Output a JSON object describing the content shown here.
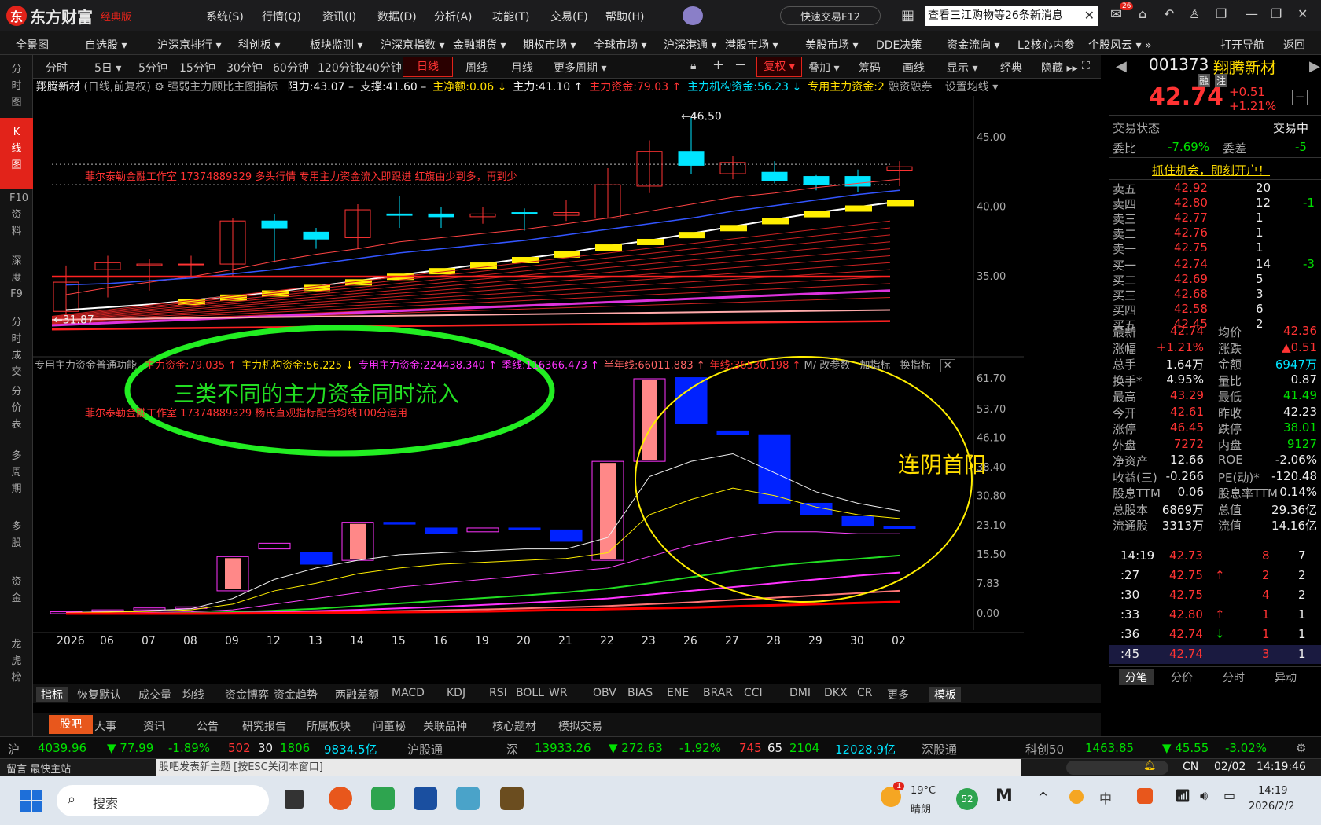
{
  "app": {
    "logo_text": "东方财富",
    "edition": "经典版"
  },
  "menu": [
    "系统(S)",
    "行情(Q)",
    "资讯(I)",
    "数据(D)",
    "分析(A)",
    "功能(T)",
    "交易(E)",
    "帮助(H)"
  ],
  "quick_trade": "快速交易F12",
  "search_notice": "查看三江购物等26条新消息",
  "mail_badge": "26",
  "nav": [
    "全景图",
    "自选股 ▾",
    "沪深京排行 ▾",
    "科创板 ▾",
    "板块监测 ▾",
    "沪深京指数 ▾",
    "金融期货 ▾",
    "期权市场 ▾",
    "全球市场 ▾",
    "沪深港通 ▾",
    "港股市场 ▾",
    "美股市场 ▾",
    "DDE决策",
    "资金流向 ▾",
    "L2核心内参",
    "个股风云 ▾ »",
    "打开导航",
    "返回"
  ],
  "left_strip": [
    "分时图",
    "K线图",
    "F10资料",
    "深度F9",
    "分时成交",
    "分价表",
    "多周期",
    "多股",
    "资金",
    "龙虎榜"
  ],
  "periods": [
    "分时",
    "5日 ▾",
    "5分钟",
    "15分钟",
    "30分钟",
    "60分钟",
    "120分钟",
    "240分钟",
    "日线",
    "周线",
    "月线",
    "更多周期 ▾"
  ],
  "toolbar": [
    "复权 ▾",
    "叠加 ▾",
    "筹码",
    "画线",
    "显示 ▾",
    "经典",
    "隐藏 ▸▸"
  ],
  "kline_header": {
    "name": "翔腾新材",
    "mode": "(日线,前复权)",
    "indicator": "强弱主力顾比主图指标",
    "items": [
      {
        "t": "阻力:43.07 –",
        "c": "#eee"
      },
      {
        "t": "支撑:41.60 –",
        "c": "#eee"
      },
      {
        "t": "主净额:0.06 ↓",
        "c": "#ffdd00"
      },
      {
        "t": "主力:41.10 ↑",
        "c": "#eee"
      },
      {
        "t": "主力资金:79.03 ↑",
        "c": "#ff3333"
      },
      {
        "t": "主力机构资金:56.23 ↓",
        "c": "#00e5ff"
      },
      {
        "t": "专用主力资金:2",
        "c": "#ffdd00"
      }
    ],
    "extra": "融资融券",
    "settings": "设置均线 ▾"
  },
  "kline_yaxis": [
    "45.00",
    "40.00",
    "35.00"
  ],
  "kline_high_label": "←46.50",
  "kline_low_label": "←31.87",
  "kline_note": "菲尔泰勒金融工作室 17374889329 多头行情 专用主力资金流入即跟进 红旗由少到多，再到少",
  "sub_header": {
    "name": "专用主力资金普通功能",
    "items": [
      {
        "t": "主力资金:79.035 ↑",
        "c": "#ff3333"
      },
      {
        "t": "主力机构资金:56.225 ↓",
        "c": "#ffdd00"
      },
      {
        "t": "专用主力资金:224438.340 ↑",
        "c": "#ff33ff"
      },
      {
        "t": "季线:116366.473 ↑",
        "c": "#ff33ff"
      },
      {
        "t": "半年线:66011.883 ↑",
        "c": "#ff6666"
      },
      {
        "t": "年线:36530.198 ↑",
        "c": "#ff3333"
      }
    ],
    "tools": [
      "M/",
      "改参数",
      "加指标",
      "换指标"
    ]
  },
  "sub_note": "菲尔泰勒金融工作室 17374889329 杨氏直观指标配合均线100分运用",
  "annot_green": "三类不同的主力资金同时流入",
  "annot_yellow": "连阴首阳",
  "sub_yaxis": [
    "61.70",
    "53.70",
    "46.10",
    "38.40",
    "30.80",
    "23.10",
    "15.50",
    "7.83",
    "0.00"
  ],
  "date_axis": [
    "2026",
    "06",
    "07",
    "08",
    "09",
    "12",
    "13",
    "14",
    "15",
    "16",
    "19",
    "20",
    "21",
    "22",
    "23",
    "26",
    "27",
    "28",
    "29",
    "30",
    "02"
  ],
  "bottom_indicators": [
    "指标",
    "恢复默认",
    "成交量",
    "均线",
    "资金博弈",
    "资金趋势",
    "两融差额",
    "MACD",
    "KDJ",
    "RSI",
    "BOLL",
    "WR",
    "OBV",
    "BIAS",
    "ENE",
    "BRAR",
    "CCI",
    "DMI",
    "DKX",
    "CR",
    "更多",
    "模板"
  ],
  "info_tabs": [
    "股吧",
    "大事",
    "资讯",
    "公告",
    "研究报告",
    "所属板块",
    "问董秘",
    "关联品种",
    "核心题材",
    "模拟交易"
  ],
  "quote": {
    "code": "001373",
    "name": "翔腾新材",
    "tags": [
      "融",
      "注"
    ],
    "price": "42.74",
    "change": "+0.51",
    "pct": "+1.21%",
    "status_label": "交易状态",
    "status": "交易中",
    "weibi_label": "委比",
    "weibi": "-7.69%",
    "weicha_label": "委差",
    "weicha": "-5",
    "promo": "抓住机会，即刻开户！",
    "asks": [
      {
        "l": "卖五",
        "p": "42.92",
        "v": "20",
        "d": ""
      },
      {
        "l": "卖四",
        "p": "42.80",
        "v": "12",
        "d": "-1"
      },
      {
        "l": "卖三",
        "p": "42.77",
        "v": "1",
        "d": ""
      },
      {
        "l": "卖二",
        "p": "42.76",
        "v": "1",
        "d": ""
      },
      {
        "l": "卖一",
        "p": "42.75",
        "v": "1",
        "d": ""
      }
    ],
    "bids": [
      {
        "l": "买一",
        "p": "42.74",
        "v": "14",
        "d": "-3"
      },
      {
        "l": "买二",
        "p": "42.69",
        "v": "5",
        "d": ""
      },
      {
        "l": "买三",
        "p": "42.68",
        "v": "3",
        "d": ""
      },
      {
        "l": "买四",
        "p": "42.58",
        "v": "6",
        "d": ""
      },
      {
        "l": "买五",
        "p": "42.45",
        "v": "2",
        "d": ""
      }
    ],
    "stats": [
      [
        "最新",
        "42.74",
        "#ff3333",
        "均价",
        "42.36",
        "#ff3333"
      ],
      [
        "涨幅",
        "+1.21%",
        "#ff3333",
        "涨跌",
        "▲0.51",
        "#ff3333"
      ],
      [
        "总手",
        "1.64万",
        "#eee",
        "金额",
        "6947万",
        "#00e5ff"
      ],
      [
        "换手*",
        "4.95%",
        "#eee",
        "量比",
        "0.87",
        "#eee"
      ],
      [
        "最高",
        "43.29",
        "#ff3333",
        "最低",
        "41.49",
        "#00e000"
      ],
      [
        "今开",
        "42.61",
        "#ff3333",
        "昨收",
        "42.23",
        "#eee"
      ],
      [
        "涨停",
        "46.45",
        "#ff3333",
        "跌停",
        "38.01",
        "#00e000"
      ],
      [
        "外盘",
        "7272",
        "#ff3333",
        "内盘",
        "9127",
        "#00e000"
      ],
      [
        "净资产",
        "12.66",
        "#eee",
        "ROE",
        "-2.06%",
        "#eee"
      ],
      [
        "收益(三)",
        "-0.266",
        "#eee",
        "PE(动)*",
        "-120.48",
        "#eee"
      ],
      [
        "股息TTM",
        "0.06",
        "#eee",
        "股息率TTM",
        "0.14%",
        "#eee"
      ],
      [
        "总股本",
        "6869万",
        "#eee",
        "总值",
        "29.36亿",
        "#eee"
      ],
      [
        "流通股",
        "3313万",
        "#eee",
        "流值",
        "14.16亿",
        "#eee"
      ]
    ],
    "ticks": [
      {
        "t": "14:19",
        "p": "42.73",
        "v": "8",
        "n": "7",
        "a": ""
      },
      {
        "t": ":27",
        "p": "42.75",
        "v": "2",
        "n": "2",
        "a": "↑"
      },
      {
        "t": ":30",
        "p": "42.75",
        "v": "4",
        "n": "2",
        "a": ""
      },
      {
        "t": ":33",
        "p": "42.80",
        "v": "1",
        "n": "1",
        "a": "↑"
      },
      {
        "t": ":36",
        "p": "42.74",
        "v": "1",
        "n": "1",
        "a": "↓"
      },
      {
        "t": ":45",
        "p": "42.74",
        "v": "3",
        "n": "1",
        "a": ""
      }
    ],
    "tabs": [
      "分笔",
      "分价",
      "分时",
      "异动"
    ]
  },
  "index_bar": {
    "sh": {
      "l": "沪",
      "v": "4039.96",
      "chg": "▼ 77.99",
      "pct": "-1.89%",
      "u": "502",
      "f": "30",
      "d": "1806",
      "amt": "9834.5亿"
    },
    "hgt": "沪股通",
    "sz": {
      "l": "深",
      "v": "13933.26",
      "chg": "▼ 272.63",
      "pct": "-1.92%",
      "u": "745",
      "f": "65",
      "d": "2104",
      "amt": "12028.9亿"
    },
    "sgt": "深股通",
    "kc": {
      "l": "科创50",
      "v": "1463.85",
      "chg": "▼ 45.55",
      "pct": "-3.02%"
    }
  },
  "status_bar": {
    "left": "留言  最快主站",
    "popup": "股吧发表新主题 [按ESC关闭本窗口]",
    "lang": "CN",
    "date": "02/02",
    "time": "14:19:46"
  },
  "taskbar": {
    "search": "搜索",
    "weather_temp": "19°C",
    "weather_desc": "晴朗",
    "weather_badge": "1",
    "badge52": "52",
    "time": "14:19",
    "date": "2026/2/2"
  },
  "colors": {
    "up": "#ff3333",
    "down": "#00e000",
    "accent": "#e2231a"
  }
}
